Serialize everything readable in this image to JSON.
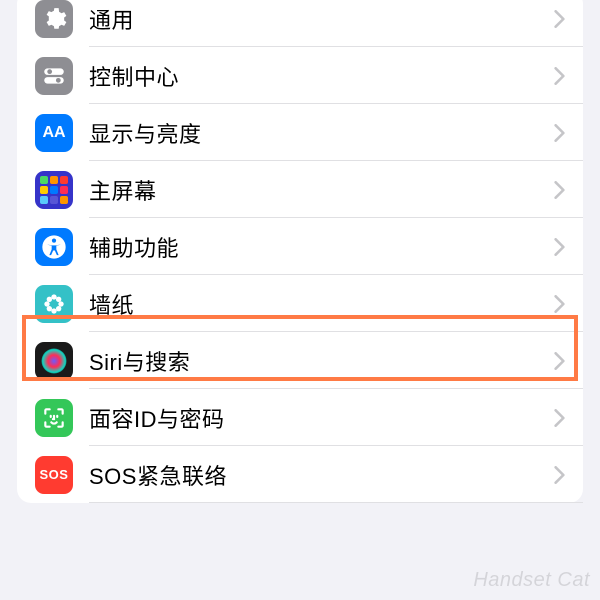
{
  "rows": [
    {
      "id": "general",
      "label": "通用",
      "icon": "gear-icon"
    },
    {
      "id": "control-center",
      "label": "控制中心",
      "icon": "toggles-icon"
    },
    {
      "id": "display-brightness",
      "label": "显示与亮度",
      "icon": "text-size-icon"
    },
    {
      "id": "home-screen",
      "label": "主屏幕",
      "icon": "app-grid-icon"
    },
    {
      "id": "accessibility",
      "label": "辅助功能",
      "icon": "accessibility-icon"
    },
    {
      "id": "wallpaper",
      "label": "墙纸",
      "icon": "flower-icon"
    },
    {
      "id": "siri-search",
      "label": "Siri与搜索",
      "icon": "siri-icon"
    },
    {
      "id": "face-id-passcode",
      "label": "面容ID与密码",
      "icon": "faceid-icon"
    },
    {
      "id": "emergency-sos",
      "label": "SOS紧急联络",
      "icon": "sos-icon"
    }
  ],
  "highlighted_row": "wallpaper",
  "watermark": "Handset Cat",
  "icon_text": {
    "display": "AA",
    "sos": "SOS"
  }
}
